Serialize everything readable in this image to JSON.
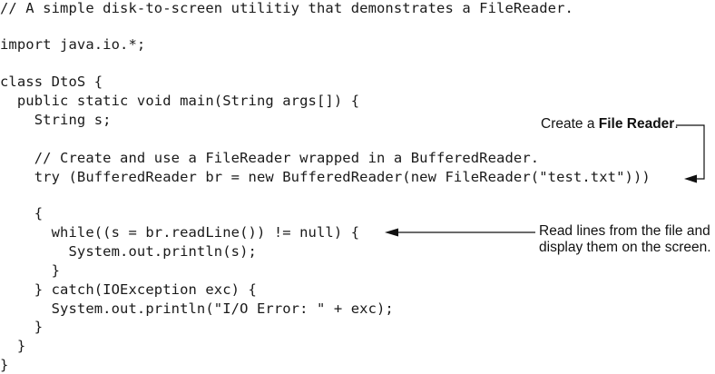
{
  "code_lines": [
    "// A simple disk-to-screen utilitiy that demonstrates a FileReader.",
    "",
    "import java.io.*;",
    "",
    "class DtoS {",
    "  public static void main(String args[]) {",
    "    String s;",
    "",
    "    // Create and use a FileReader wrapped in a BufferedReader.",
    "    try (BufferedReader br = new BufferedReader(new FileReader(\"test.txt\")))",
    "",
    "    {",
    "      while((s = br.readLine()) != null) {",
    "        System.out.println(s);",
    "      }",
    "    } catch(IOException exc) {",
    "      System.out.println(\"I/O Error: \" + exc);",
    "    }",
    "  }",
    "}"
  ],
  "annotations": {
    "file_reader": {
      "prefix": "Create a ",
      "bold": "File Reader",
      "suffix": "."
    },
    "read_lines": {
      "line1": "Read lines from the file and",
      "line2": "display them on the screen."
    }
  }
}
